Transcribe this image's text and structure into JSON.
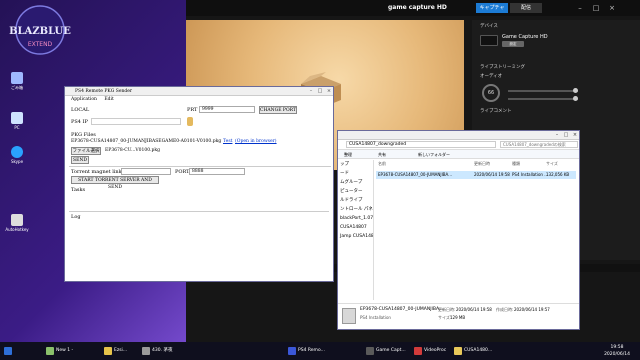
{
  "desktop": {
    "logo_text": "BLAZBLUE",
    "logo_sub": "EXTEND",
    "icons": [
      "ごみ箱",
      "",
      "PC",
      "",
      "Skype",
      "",
      "AutoHotkey"
    ]
  },
  "game_capture": {
    "title": "game capture HD",
    "capture_btn": "キャプチャ",
    "stream_btn": "配信",
    "sec_device": "デバイス",
    "device_name": "Game Capture HD",
    "device_btn": "設定",
    "sec_monitoring": "ライブストリーミング",
    "sec_audio": "オーディオ",
    "volume": "66",
    "sec_commentary": "ライブコメント"
  },
  "explorer": {
    "path": "CUSA14807_downgraded",
    "search_placeholder": "CUSA14807_downgradedの検索",
    "tools": [
      "整理",
      "共有",
      "新しいフォルダー"
    ],
    "nav": [
      "",
      "",
      "",
      "ップ",
      "ード",
      "ムグループ",
      "",
      "ピューター",
      "ルドライブ",
      "ントロール パネル",
      "",
      "blackPort_1.07",
      "CUSA14807",
      "Jamp CUSA14807",
      ""
    ],
    "columns": [
      "名前",
      "更新日時",
      "種類",
      "サイズ"
    ],
    "file": {
      "name": "EP3678-CUSA14807_00-JUMANJIBA...",
      "date": "2020/06/14 19:58",
      "type": "PS4 Installation ...",
      "size": "132,056 KB"
    },
    "details": {
      "name": "EP3678-CUSA14807_00-JUMANJIBA...",
      "updated_label": "更新日時:",
      "updated": "2020/06/14 19:58",
      "created_label": "作成日時:",
      "created": "2020/06/14 19:57",
      "kind": "PS4 Installation",
      "size_label": "サイズ:",
      "size": "129 MB"
    }
  },
  "pkg_sender": {
    "title": "PS4 Remote PKG Sender",
    "menu": [
      "Application",
      "Edit"
    ],
    "local_label": "LOCAL",
    "port_label": "PRT",
    "port_value": "9999",
    "change_port_btn": "CHANGE PORT",
    "ps4ip_label": "PS4 IP",
    "pkg_files_label": "PKG Files",
    "pkg_path": "EP3678-CUSA14807_00-JUMANJIBASEGAME0-A0101-V0100.pkg",
    "test_link": "Test",
    "open_browser_link": "(Open in browser)",
    "file_select_btn": "ファイル選択",
    "file_selected": "EP3678-CU...V0100.pkg",
    "send_btn": "SEND",
    "torrent_label": "Torrent magnet link",
    "torrent_port_label": "PORT",
    "torrent_port_value": "8888",
    "start_torrent_btn": "START TORRENT SERVER AND SEND",
    "tasks_label": "Tasks",
    "log_label": "Log"
  },
  "taskbar": {
    "items": [
      "New 1 -",
      "Ezsi...",
      "430. 茅夜",
      "",
      "PS4 Remo...",
      "",
      "Game Capt...",
      "VideoProc",
      "CUSA1480...",
      ""
    ],
    "time": "19:58",
    "date": "2020/06/14"
  }
}
